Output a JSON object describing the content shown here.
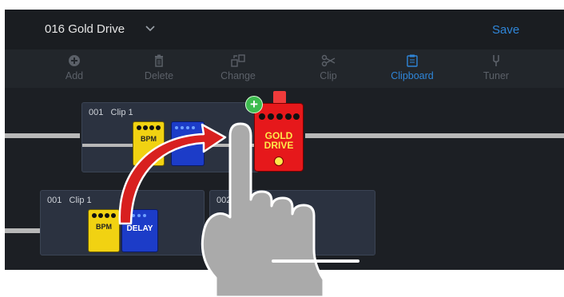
{
  "header": {
    "patch_name": "016 Gold Drive",
    "save_label": "Save"
  },
  "toolbar": {
    "items": [
      {
        "label": "Add",
        "icon": "add-icon",
        "active": false
      },
      {
        "label": "Delete",
        "icon": "trash-icon",
        "active": false
      },
      {
        "label": "Change",
        "icon": "change-icon",
        "active": false
      },
      {
        "label": "Clip",
        "icon": "scissors-icon",
        "active": false
      },
      {
        "label": "Clipboard",
        "icon": "clipboard-icon",
        "active": true
      },
      {
        "label": "Tuner",
        "icon": "tuner-fork-icon",
        "active": false
      }
    ]
  },
  "clipboard_clip": {
    "label": "001   Clip 1"
  },
  "chain_clips": [
    {
      "label": "001   Clip 1"
    },
    {
      "label": "002"
    }
  ],
  "pedals": {
    "bpm_text": "BPM",
    "delay_text": "DELAY",
    "gold_drive_text": "GOLD DRIVE"
  },
  "colors": {
    "accent": "#2f86d9",
    "background": "#1b1e22",
    "clip_bg": "#2b3240",
    "gold_drive": "#e6181b",
    "bpm_pedal": "#f1d212",
    "delay_pedal": "#1c3cc8",
    "arrow": "#d8201f",
    "add_badge": "#3dbb4f"
  }
}
